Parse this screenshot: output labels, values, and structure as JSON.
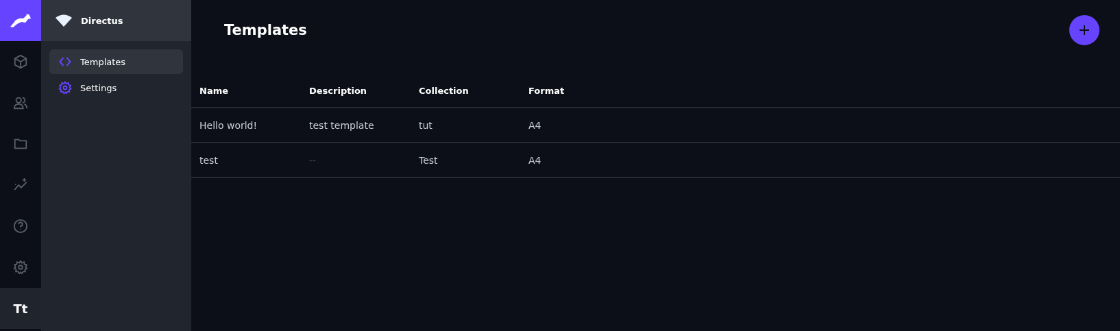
{
  "modules": [
    {
      "kind": "cube",
      "selected": false
    },
    {
      "kind": "users",
      "selected": false
    },
    {
      "kind": "folder",
      "selected": false
    },
    {
      "kind": "insights",
      "selected": false
    },
    {
      "kind": "help",
      "selected": false
    },
    {
      "kind": "settings",
      "selected": false
    },
    {
      "kind": "text",
      "label": "Tt",
      "selected": true
    }
  ],
  "project": {
    "name": "Directus"
  },
  "nav": [
    {
      "label": "Templates",
      "kind": "code",
      "selected": true
    },
    {
      "label": "Settings",
      "kind": "settings",
      "selected": false
    }
  ],
  "page": {
    "title": "Templates"
  },
  "table": {
    "columns": [
      "Name",
      "Description",
      "Collection",
      "Format"
    ],
    "rows": [
      {
        "cells": [
          {
            "text": "Hello world!",
            "empty": false
          },
          {
            "text": "test template",
            "empty": false
          },
          {
            "text": "tut",
            "empty": false
          },
          {
            "text": "A4",
            "empty": false
          }
        ]
      },
      {
        "cells": [
          {
            "text": "test",
            "empty": false
          },
          {
            "text": "--",
            "empty": true
          },
          {
            "text": "Test",
            "empty": false
          },
          {
            "text": "A4",
            "empty": false
          }
        ]
      }
    ]
  }
}
